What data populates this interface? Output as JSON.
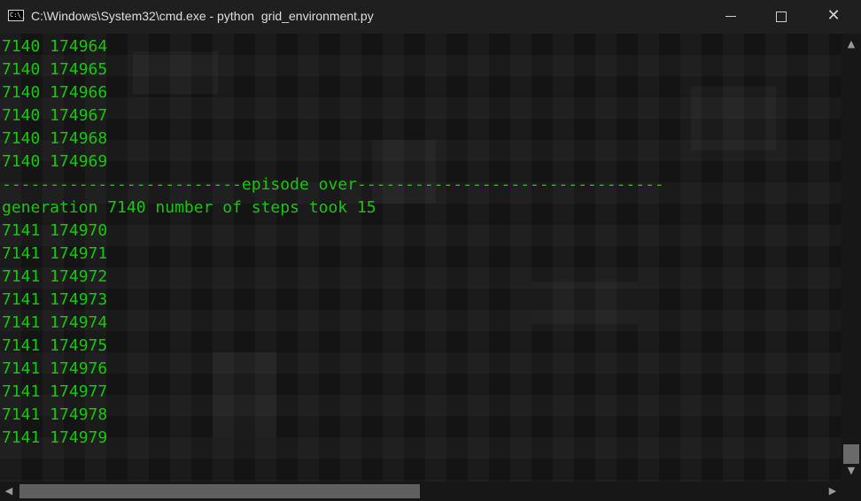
{
  "window": {
    "title": "C:\\Windows\\System32\\cmd.exe - python  grid_environment.py",
    "icon_glyph": "C:\\_",
    "minimize_label": "minimize",
    "maximize_label": "maximize",
    "close_glyph": "✕"
  },
  "console": {
    "text_color": "#16c60c",
    "background_color": "#161616",
    "lines": [
      "7140 174964",
      "7140 174965",
      "7140 174966",
      "7140 174967",
      "7140 174968",
      "7140 174969",
      "-------------------------episode over--------------------------------",
      "generation 7140 number of steps took 15",
      "7141 174970",
      "7141 174971",
      "7141 174972",
      "7141 174973",
      "7141 174974",
      "7141 174975",
      "7141 174976",
      "7141 174977",
      "7141 174978",
      "7141 174979"
    ]
  },
  "scrollbars": {
    "vertical_up_glyph": "▲",
    "vertical_down_glyph": "▼",
    "horizontal_left_glyph": "◀",
    "horizontal_right_glyph": "▶"
  }
}
